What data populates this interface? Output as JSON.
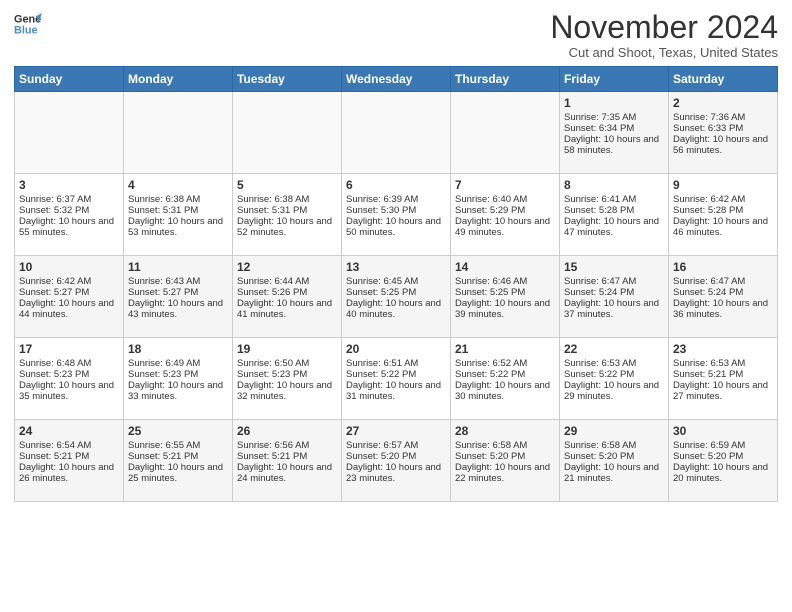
{
  "logo": {
    "line1": "General",
    "line2": "Blue"
  },
  "title": "November 2024",
  "subtitle": "Cut and Shoot, Texas, United States",
  "days_of_week": [
    "Sunday",
    "Monday",
    "Tuesday",
    "Wednesday",
    "Thursday",
    "Friday",
    "Saturday"
  ],
  "weeks": [
    [
      {
        "day": "",
        "info": ""
      },
      {
        "day": "",
        "info": ""
      },
      {
        "day": "",
        "info": ""
      },
      {
        "day": "",
        "info": ""
      },
      {
        "day": "",
        "info": ""
      },
      {
        "day": "1",
        "info": "Sunrise: 7:35 AM\nSunset: 6:34 PM\nDaylight: 10 hours and 58 minutes."
      },
      {
        "day": "2",
        "info": "Sunrise: 7:36 AM\nSunset: 6:33 PM\nDaylight: 10 hours and 56 minutes."
      }
    ],
    [
      {
        "day": "3",
        "info": "Sunrise: 6:37 AM\nSunset: 5:32 PM\nDaylight: 10 hours and 55 minutes."
      },
      {
        "day": "4",
        "info": "Sunrise: 6:38 AM\nSunset: 5:31 PM\nDaylight: 10 hours and 53 minutes."
      },
      {
        "day": "5",
        "info": "Sunrise: 6:38 AM\nSunset: 5:31 PM\nDaylight: 10 hours and 52 minutes."
      },
      {
        "day": "6",
        "info": "Sunrise: 6:39 AM\nSunset: 5:30 PM\nDaylight: 10 hours and 50 minutes."
      },
      {
        "day": "7",
        "info": "Sunrise: 6:40 AM\nSunset: 5:29 PM\nDaylight: 10 hours and 49 minutes."
      },
      {
        "day": "8",
        "info": "Sunrise: 6:41 AM\nSunset: 5:28 PM\nDaylight: 10 hours and 47 minutes."
      },
      {
        "day": "9",
        "info": "Sunrise: 6:42 AM\nSunset: 5:28 PM\nDaylight: 10 hours and 46 minutes."
      }
    ],
    [
      {
        "day": "10",
        "info": "Sunrise: 6:42 AM\nSunset: 5:27 PM\nDaylight: 10 hours and 44 minutes."
      },
      {
        "day": "11",
        "info": "Sunrise: 6:43 AM\nSunset: 5:27 PM\nDaylight: 10 hours and 43 minutes."
      },
      {
        "day": "12",
        "info": "Sunrise: 6:44 AM\nSunset: 5:26 PM\nDaylight: 10 hours and 41 minutes."
      },
      {
        "day": "13",
        "info": "Sunrise: 6:45 AM\nSunset: 5:25 PM\nDaylight: 10 hours and 40 minutes."
      },
      {
        "day": "14",
        "info": "Sunrise: 6:46 AM\nSunset: 5:25 PM\nDaylight: 10 hours and 39 minutes."
      },
      {
        "day": "15",
        "info": "Sunrise: 6:47 AM\nSunset: 5:24 PM\nDaylight: 10 hours and 37 minutes."
      },
      {
        "day": "16",
        "info": "Sunrise: 6:47 AM\nSunset: 5:24 PM\nDaylight: 10 hours and 36 minutes."
      }
    ],
    [
      {
        "day": "17",
        "info": "Sunrise: 6:48 AM\nSunset: 5:23 PM\nDaylight: 10 hours and 35 minutes."
      },
      {
        "day": "18",
        "info": "Sunrise: 6:49 AM\nSunset: 5:23 PM\nDaylight: 10 hours and 33 minutes."
      },
      {
        "day": "19",
        "info": "Sunrise: 6:50 AM\nSunset: 5:23 PM\nDaylight: 10 hours and 32 minutes."
      },
      {
        "day": "20",
        "info": "Sunrise: 6:51 AM\nSunset: 5:22 PM\nDaylight: 10 hours and 31 minutes."
      },
      {
        "day": "21",
        "info": "Sunrise: 6:52 AM\nSunset: 5:22 PM\nDaylight: 10 hours and 30 minutes."
      },
      {
        "day": "22",
        "info": "Sunrise: 6:53 AM\nSunset: 5:22 PM\nDaylight: 10 hours and 29 minutes."
      },
      {
        "day": "23",
        "info": "Sunrise: 6:53 AM\nSunset: 5:21 PM\nDaylight: 10 hours and 27 minutes."
      }
    ],
    [
      {
        "day": "24",
        "info": "Sunrise: 6:54 AM\nSunset: 5:21 PM\nDaylight: 10 hours and 26 minutes."
      },
      {
        "day": "25",
        "info": "Sunrise: 6:55 AM\nSunset: 5:21 PM\nDaylight: 10 hours and 25 minutes."
      },
      {
        "day": "26",
        "info": "Sunrise: 6:56 AM\nSunset: 5:21 PM\nDaylight: 10 hours and 24 minutes."
      },
      {
        "day": "27",
        "info": "Sunrise: 6:57 AM\nSunset: 5:20 PM\nDaylight: 10 hours and 23 minutes."
      },
      {
        "day": "28",
        "info": "Sunrise: 6:58 AM\nSunset: 5:20 PM\nDaylight: 10 hours and 22 minutes."
      },
      {
        "day": "29",
        "info": "Sunrise: 6:58 AM\nSunset: 5:20 PM\nDaylight: 10 hours and 21 minutes."
      },
      {
        "day": "30",
        "info": "Sunrise: 6:59 AM\nSunset: 5:20 PM\nDaylight: 10 hours and 20 minutes."
      }
    ]
  ]
}
